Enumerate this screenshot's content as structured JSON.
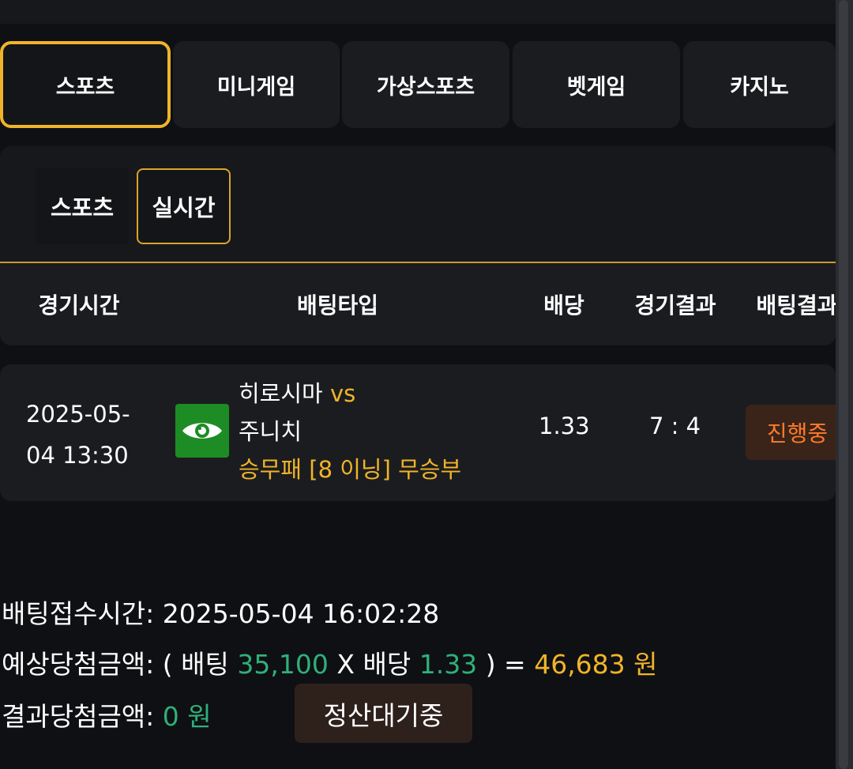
{
  "nav_tabs": [
    {
      "label": "스포츠",
      "active": true
    },
    {
      "label": "미니게임",
      "active": false
    },
    {
      "label": "가상스포츠",
      "active": false
    },
    {
      "label": "벳게임",
      "active": false
    },
    {
      "label": "카지노",
      "active": false
    }
  ],
  "sub_tabs": [
    {
      "label": "스포츠",
      "active": false
    },
    {
      "label": "실시간",
      "active": true
    }
  ],
  "table": {
    "headers": {
      "time": "경기시간",
      "bet_type": "배팅타입",
      "odds": "배당",
      "game_result": "경기결과",
      "bet_result": "배팅결과"
    },
    "row": {
      "date_line1": "2025-05-",
      "date_line2": "04 13:30",
      "icon": "eye-icon",
      "home_team": "히로시마",
      "vs": "vs",
      "away_team": "주니치",
      "market": "승무패 [8 이닝] 무승부",
      "odds": "1.33",
      "score": "7 : 4",
      "status": "진행중"
    }
  },
  "summary": {
    "bet_time_label": "배팅접수시간:",
    "bet_time_value": "2025-05-04 16:02:28",
    "expected_label": "예상당첨금액:",
    "open_paren": "(",
    "bet_label": "배팅",
    "bet_amount": "35,100",
    "times": "X",
    "odds_label": "배당",
    "odds_value": "1.33",
    "close_paren_eq": ") =",
    "expected_amount": "46,683 원",
    "result_label": "결과당첨금액:",
    "result_amount": "0 원",
    "settle_button": "정산대기중"
  },
  "colors": {
    "accent_gold": "#f0b429",
    "green_value": "#2fb07a",
    "status_orange": "#ff7a2a",
    "eye_icon_bg": "#1e8c24"
  }
}
